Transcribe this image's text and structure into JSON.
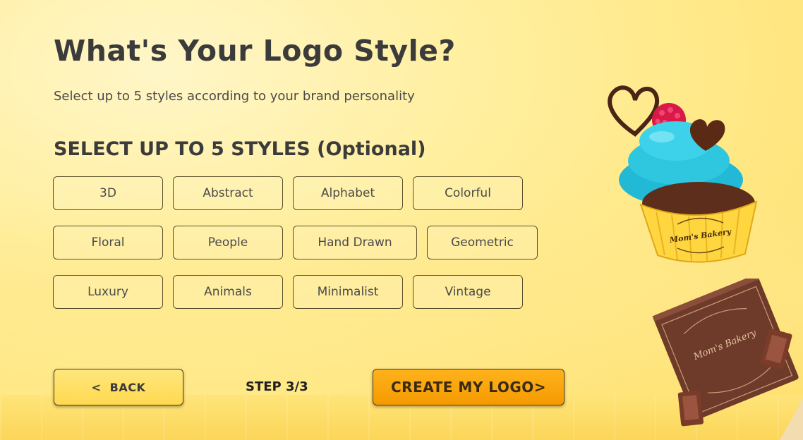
{
  "header": {
    "title": "What's Your Logo Style?",
    "subtitle": "Select up to 5 styles according to your brand personality"
  },
  "styles_section": {
    "heading": "SELECT UP TO 5 STYLES (Optional)",
    "styles": [
      "3D",
      "Abstract",
      "Alphabet",
      "Colorful",
      "Floral",
      "People",
      "Hand Drawn",
      "Geometric",
      "Luxury",
      "Animals",
      "Minimalist",
      "Vintage"
    ]
  },
  "footer": {
    "back_label": "<  BACK",
    "step_text": "STEP 3/3",
    "create_label": "CREATE MY LOGO>"
  },
  "illustration": {
    "cupcake_label": "Mom's Bakery",
    "chocolate_label": "Mom's Bakery"
  },
  "colors": {
    "background": "#ffe885",
    "create_button": "#ffa80d",
    "back_button": "#ffde5f",
    "frosting": "#2fc6e0"
  }
}
